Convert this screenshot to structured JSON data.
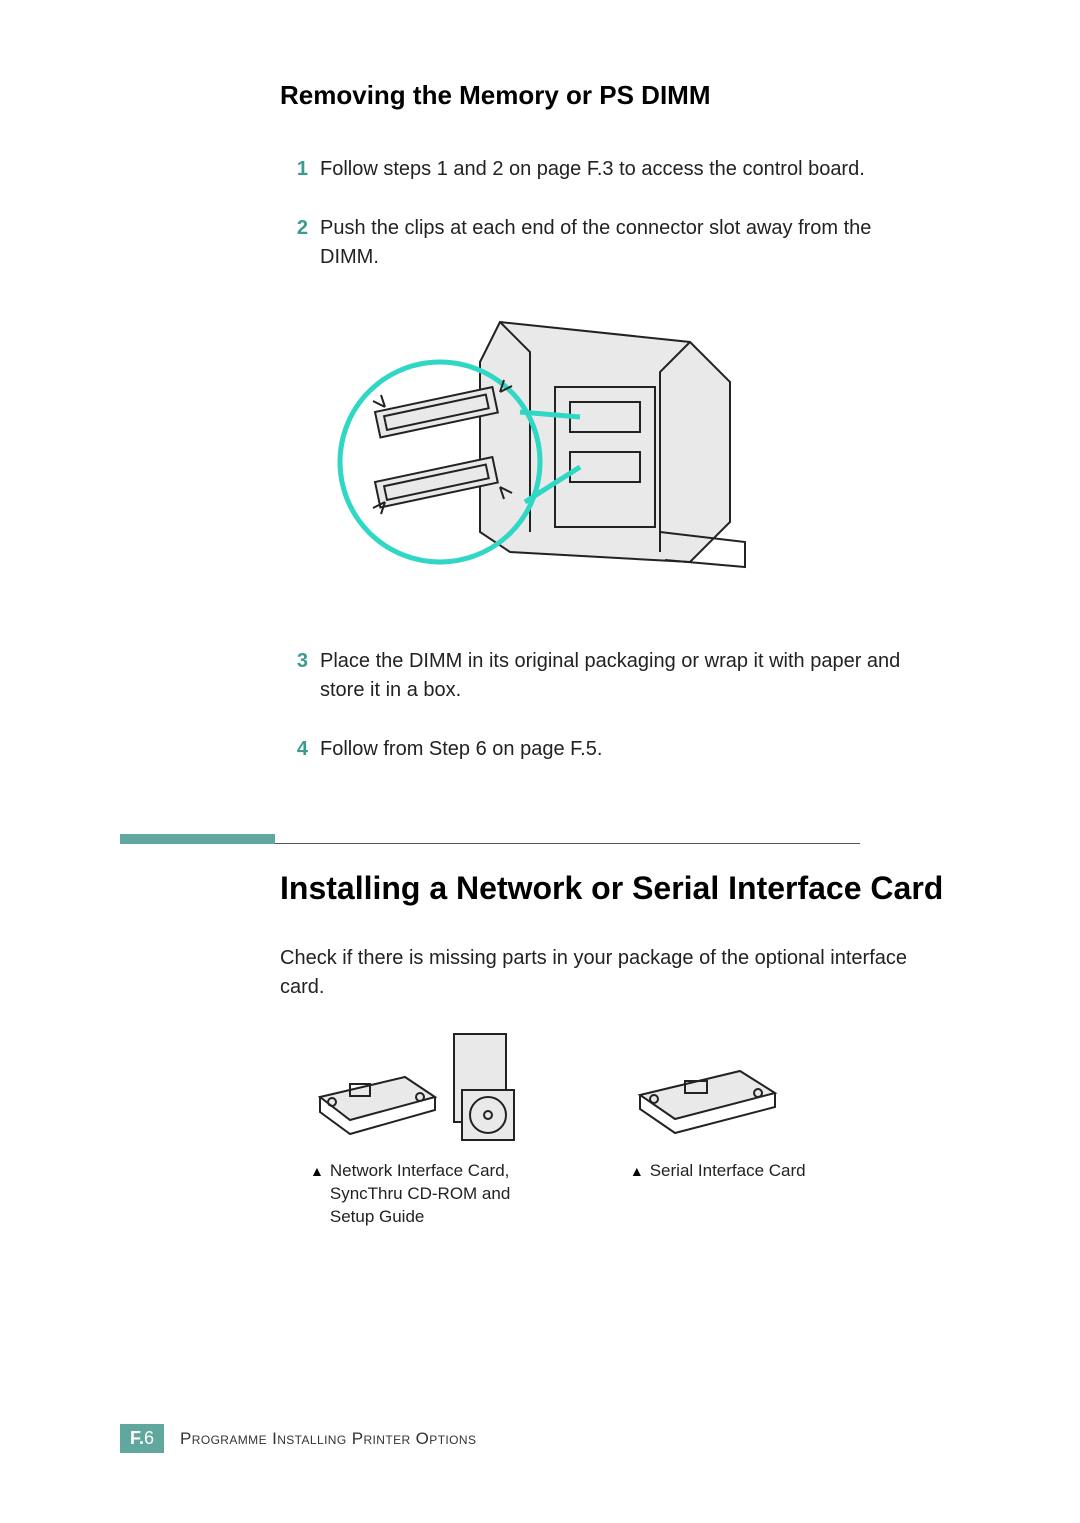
{
  "section1": {
    "heading": "Removing the Memory or PS DIMM",
    "steps": [
      {
        "num": "1",
        "text": "Follow steps 1 and 2 on page F.3 to access the control board."
      },
      {
        "num": "2",
        "text": "Push the clips at each end of the connector slot away from the DIMM."
      },
      {
        "num": "3",
        "text": "Place the DIMM in its original packaging or wrap it with paper and store it in a box."
      },
      {
        "num": "4",
        "text": "Follow from Step 6 on page F.5."
      }
    ]
  },
  "section2": {
    "heading": "Installing a Network or Serial Interface Card",
    "intro": "Check if there is missing parts in your package of the optional interface card.",
    "packages": [
      {
        "caption": "Network Interface Card, SyncThru CD-ROM and Setup Guide"
      },
      {
        "caption": "Serial Interface Card"
      }
    ]
  },
  "footer": {
    "page_prefix": "F.",
    "page_number": "6",
    "title": "Programme Installing Printer Options"
  },
  "icons": {
    "caption_marker": "▲"
  }
}
